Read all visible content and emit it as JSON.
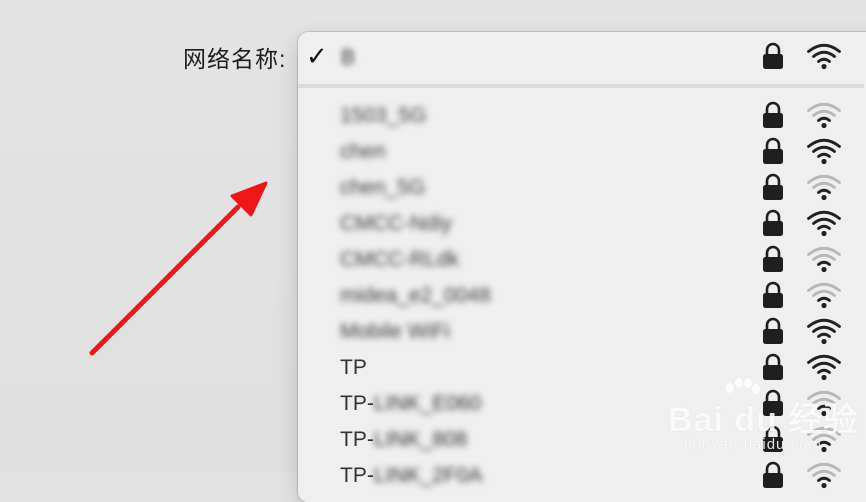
{
  "field_label": "网络名称:",
  "selected": {
    "check_icon": "✓",
    "name": "B",
    "secured": true,
    "signal": 3
  },
  "networks": [
    {
      "name": "1503_5G",
      "blurred": true,
      "signal": 1
    },
    {
      "name": "chen",
      "blurred": true,
      "signal": 3
    },
    {
      "name": "chen_5G",
      "blurred": true,
      "signal": 1
    },
    {
      "name": "CMCC-Ndiy",
      "blurred": true,
      "signal": 3
    },
    {
      "name": "CMCC-RLdk",
      "blurred": true,
      "signal": 1
    },
    {
      "name": "midea_e2_0048",
      "blurred": true,
      "signal": 1
    },
    {
      "name": "Mobile WiFi",
      "blurred": true,
      "signal": 3
    },
    {
      "name": "TP",
      "blurred": false,
      "signal": 3
    },
    {
      "name_visible": "TP-",
      "name_hidden": "LINK_E060",
      "blurred": "partial",
      "signal": 1
    },
    {
      "name_visible": "TP-",
      "name_hidden": "LINK_808",
      "blurred": "partial",
      "signal": 1
    },
    {
      "name_visible": "TP-",
      "name_hidden": "LINK_2F0A",
      "blurred": "partial",
      "signal": 1
    }
  ],
  "icons": {
    "lock": "lock-icon",
    "wifi": "wifi-icon",
    "annotation": "red-arrow"
  },
  "colors": {
    "arrow": "#f01616",
    "wifi_strong": "#222222",
    "wifi_weak": "#b8b8b8"
  },
  "watermark": {
    "main": "Bai du 经验",
    "sub": "jingyan.baidu.com"
  }
}
